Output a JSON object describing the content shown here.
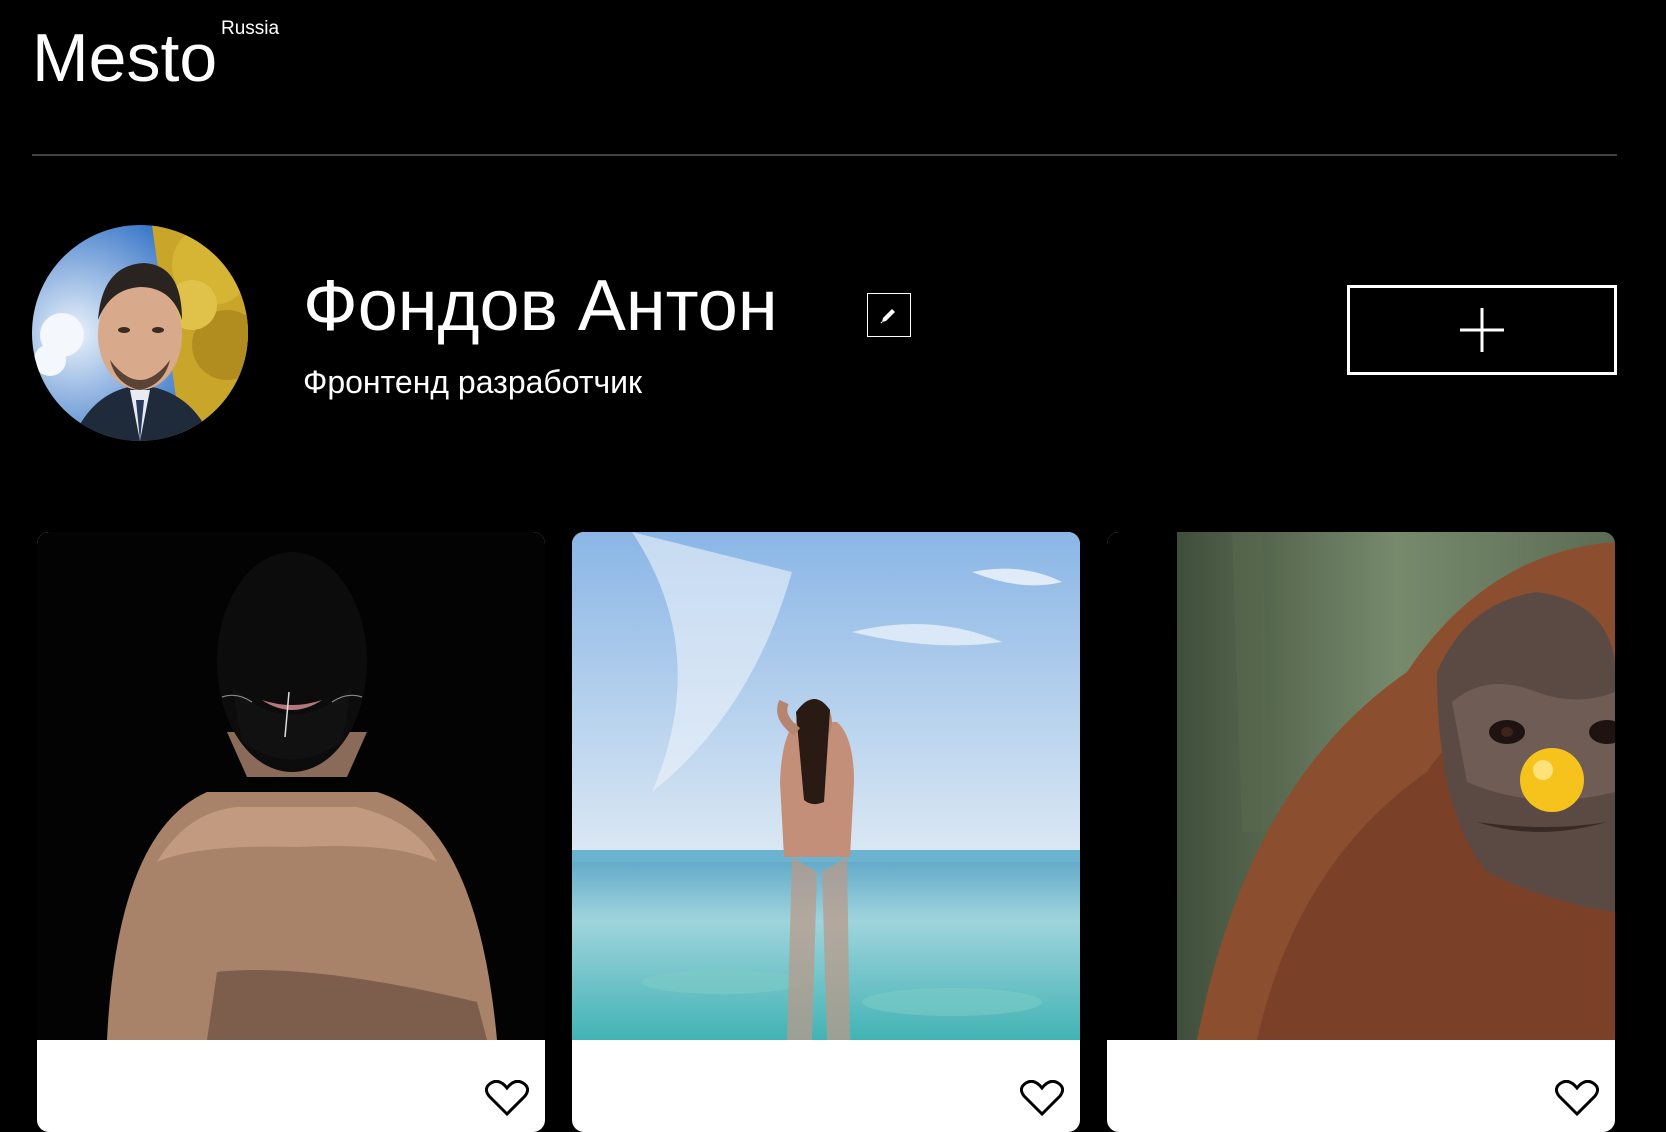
{
  "header": {
    "logo_text": "Mesto",
    "logo_sup": "Russia"
  },
  "profile": {
    "name": "Фондов Антон",
    "about": "Фронтенд разработчик",
    "edit_icon": "pencil-icon",
    "add_icon": "plus-icon"
  },
  "cards": [
    {
      "title": "",
      "image": "masked-portrait",
      "like_icon": "heart-icon"
    },
    {
      "title": "",
      "image": "woman-in-sea",
      "like_icon": "heart-icon"
    },
    {
      "title": "",
      "image": "orangutan-clown-nose",
      "like_icon": "heart-icon"
    }
  ],
  "colors": {
    "background": "#000000",
    "text": "#ffffff",
    "divider": "#545454",
    "card": "#ffffff"
  }
}
